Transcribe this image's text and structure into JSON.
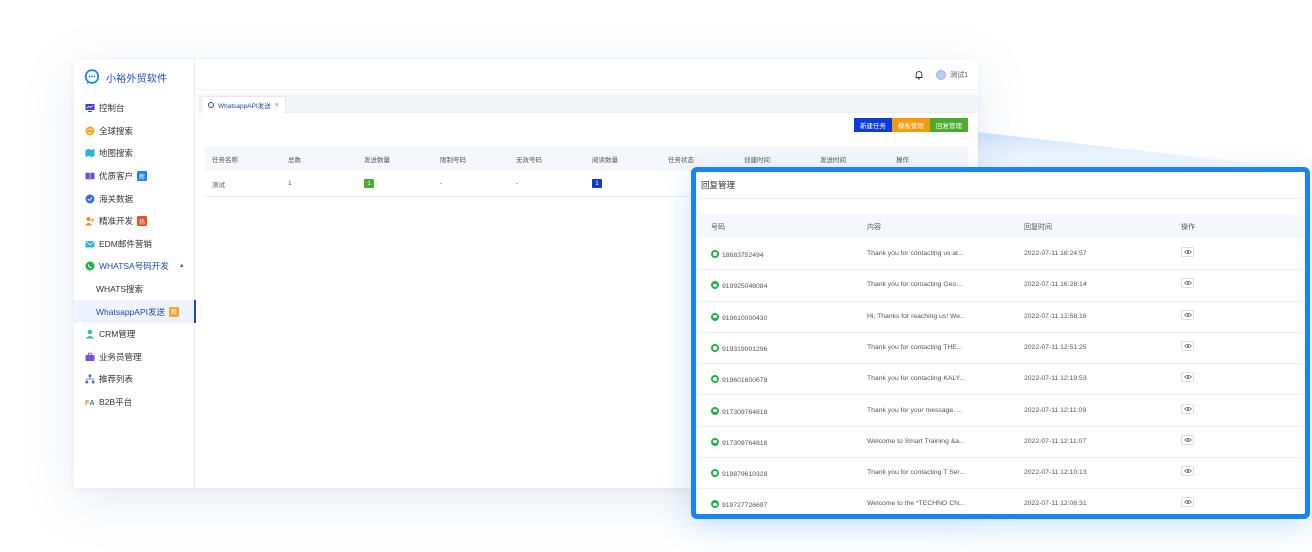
{
  "app": {
    "logo_text": "小裕外贸软件",
    "user_name": "测试1"
  },
  "sidebar": {
    "items": [
      {
        "label": "控制台",
        "icon": "monitor-icon",
        "color": "#3b3fd4"
      },
      {
        "label": "全球搜索",
        "icon": "globe-icon",
        "color": "#f5a623"
      },
      {
        "label": "地图搜索",
        "icon": "map-icon",
        "color": "#2bb5d6"
      },
      {
        "label": "优质客户",
        "icon": "book-icon",
        "color": "#6c4fd6",
        "badge": "新",
        "badge_color": "#1a84f5"
      },
      {
        "label": "海关数据",
        "icon": "shield-icon",
        "color": "#3b6fe0"
      },
      {
        "label": "精准开发",
        "icon": "people-icon",
        "color": "#f08a24",
        "badge": "热",
        "badge_color": "#f04e23"
      },
      {
        "label": "EDM邮件营销",
        "icon": "mail-icon",
        "color": "#2bb5d6"
      },
      {
        "label": "WHATSA号码开发",
        "icon": "whatsapp-icon",
        "color": "#25b04a"
      },
      {
        "label": "WHATS搜索"
      },
      {
        "label": "WhatsappAPI发送",
        "badge": "新",
        "badge_color": "#f5a623"
      },
      {
        "label": "CRM管理",
        "icon": "user-icon",
        "color": "#2bc3a5"
      },
      {
        "label": "业务员管理",
        "icon": "briefcase-icon",
        "color": "#7b4fe0"
      },
      {
        "label": "推荐列表",
        "icon": "tree-icon",
        "color": "#3b6fe0"
      },
      {
        "label": "B2B平台",
        "icon": "fa-icon",
        "color": "#f08a24"
      }
    ]
  },
  "tab": {
    "label": "WhatsappAPI发送",
    "close": "×"
  },
  "actions": {
    "new_task": "新建任务",
    "template": "模板管理",
    "reply": "回复管理"
  },
  "task_table": {
    "headers": [
      "任务名称",
      "总数",
      "发送数量",
      "限制号码",
      "无效号码",
      "阅读数量",
      "任务状态",
      "创建时间",
      "发送时间",
      "操作"
    ],
    "row": {
      "name": "测试",
      "total": "1",
      "sent": "1",
      "limited": "-",
      "invalid": "-",
      "read": "1"
    }
  },
  "reply_panel": {
    "title": "回复管理",
    "headers": {
      "number": "号码",
      "content": "内容",
      "time": "回复时间",
      "op": "操作"
    },
    "rows": [
      {
        "number": "18683752494",
        "content": "Thank you for contacting us at...",
        "time": "2022-07-11 18:24:57"
      },
      {
        "number": "919925048084",
        "content": "Thank you for contacting Geo...",
        "time": "2022-07-11 16:28:14"
      },
      {
        "number": "919610000430",
        "content": "Hi, Thanks for reaching us! We...",
        "time": "2022-07-11 12:58:16"
      },
      {
        "number": "919319001296",
        "content": "Thank you for contacting THE...",
        "time": "2022-07-11 12:51:25"
      },
      {
        "number": "919601600678",
        "content": "Thank you for contacting KALY...",
        "time": "2022-07-11 12:19:53"
      },
      {
        "number": "917309764818",
        "content": "Thank you for your message. ...",
        "time": "2022-07-11 12:11:09"
      },
      {
        "number": "917309764818",
        "content": "Welcome to Smart Training &a...",
        "time": "2022-07-11 12:11:07"
      },
      {
        "number": "919879610328",
        "content": "Thank you for contacting T Ser...",
        "time": "2022-07-11 12:10:13"
      },
      {
        "number": "919727726697",
        "content": "Welcome to the *TECHNO CN...",
        "time": "2022-07-11 12:06:31"
      }
    ]
  }
}
